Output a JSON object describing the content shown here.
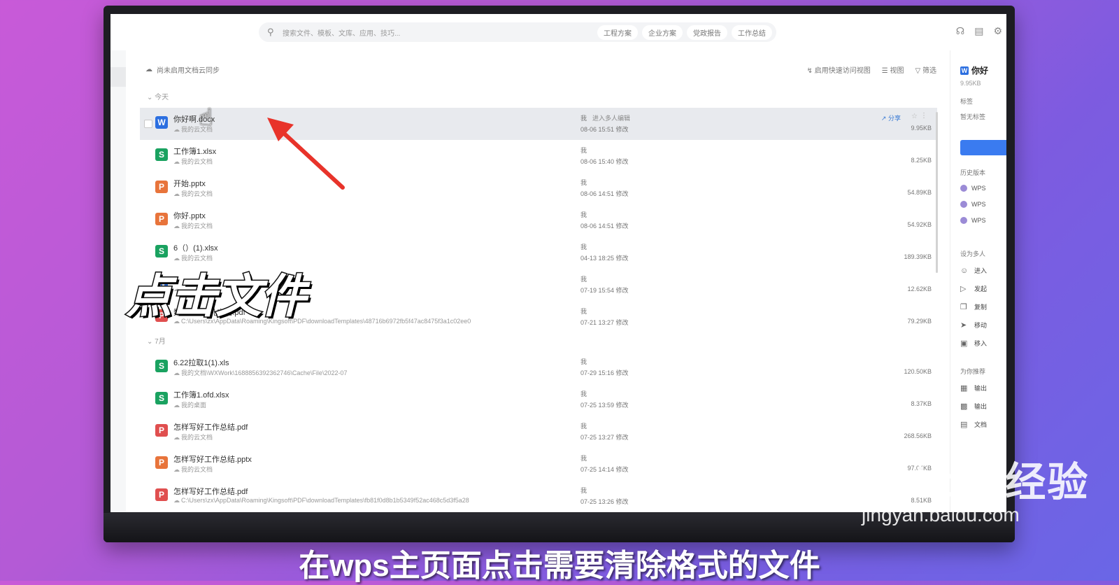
{
  "topbar": {
    "search_placeholder": "搜索文件、模板、文库、应用、技巧...",
    "chips": [
      "工程方案",
      "企业方案",
      "党政报告",
      "工作总结"
    ]
  },
  "toolbar": {
    "sync_text": "尚未启用文档云同步",
    "quick_view": "启用快速访问视图",
    "view": "视图",
    "filter": "筛选"
  },
  "groups": {
    "today": "今天",
    "july": "7月"
  },
  "files_today": [
    {
      "name": "你好啊.docx",
      "location": "我的云文档",
      "owner": "我",
      "collab": "进入多人编辑",
      "modified": "08-06 15:51 修改",
      "size": "9.95KB",
      "type": "W",
      "color": "#2c6fe0"
    },
    {
      "name": "工作簿1.xlsx",
      "location": "我的云文档",
      "owner": "我",
      "modified": "08-06 15:40 修改",
      "size": "8.25KB",
      "type": "S",
      "color": "#1aa260"
    },
    {
      "name": "开始.pptx",
      "location": "我的云文档",
      "owner": "我",
      "modified": "08-06 14:51 修改",
      "size": "54.89KB",
      "type": "P",
      "color": "#e8743b"
    },
    {
      "name": "你好.pptx",
      "location": "我的云文档",
      "owner": "我",
      "modified": "08-06 14:51 修改",
      "size": "54.92KB",
      "type": "P",
      "color": "#e8743b"
    },
    {
      "name": "6（）(1).xlsx",
      "location": "我的云文档",
      "owner": "我",
      "modified": "04-13 18:25 修改",
      "size": "189.39KB",
      "type": "S",
      "color": "#1aa260"
    },
    {
      "name": "",
      "location": "",
      "owner": "我",
      "modified": "07-19 15:54 修改",
      "size": "12.62KB",
      "type": "W",
      "color": "#2c6fe0"
    },
    {
      "name": "数据入门--孔言信.pdf",
      "location": "C:\\Users\\zx\\AppData\\Roaming\\Kingsoft\\PDF\\downloadTemplates\\48716b6972fb5f47ac8475f3a1c02ee0",
      "owner": "我",
      "modified": "07-21 13:27 修改",
      "size": "79.29KB",
      "type": "P",
      "color": "#e04f4f"
    }
  ],
  "files_july": [
    {
      "name": "6.22拉取1(1).xls",
      "location": "我的文档\\WXWork\\1688856392362746\\Cache\\File\\2022-07",
      "owner": "我",
      "modified": "07-29 15:16 修改",
      "size": "120.50KB",
      "type": "S",
      "color": "#1aa260"
    },
    {
      "name": "工作簿1.ofd.xlsx",
      "location": "我的桌面",
      "owner": "我",
      "modified": "07-25 13:59 修改",
      "size": "8.37KB",
      "type": "S",
      "color": "#1aa260"
    },
    {
      "name": "怎样写好工作总结.pdf",
      "location": "我的云文档",
      "owner": "我",
      "modified": "07-25 13:27 修改",
      "size": "268.56KB",
      "type": "P",
      "color": "#e04f4f"
    },
    {
      "name": "怎样写好工作总结.pptx",
      "location": "我的云文档",
      "owner": "我",
      "modified": "07-25 14:14 修改",
      "size": "97.04KB",
      "type": "P",
      "color": "#e8743b"
    },
    {
      "name": "怎样写好工作总结.pdf",
      "location": "C:\\Users\\zx\\AppData\\Roaming\\Kingsoft\\PDF\\downloadTemplates\\fb81f0d8b1b5349f52ac468c5d3f5a28",
      "owner": "我",
      "modified": "07-25 13:26 修改",
      "size": "8.51KB",
      "type": "P",
      "color": "#e04f4f"
    }
  ],
  "row_actions": {
    "share": "分享"
  },
  "panel": {
    "title": "你好",
    "size": "9.95KB",
    "tags_label": "标签",
    "no_tags": "暂无标签",
    "history_label": "历史版本",
    "history": [
      "WPS",
      "WPS",
      "WPS"
    ],
    "multi_label": "设为多人",
    "actions": [
      "进入",
      "发起",
      "复制",
      "移动",
      "移入"
    ],
    "recommend_label": "为你推荐",
    "recommend": [
      "输出",
      "输出",
      "文档"
    ]
  },
  "overlay": {
    "title": "点击文件",
    "caption": "在wps主页面点击需要清除格式的文件",
    "watermark": "Bai du 经验",
    "watermark_url": "jingyan.baidu.com"
  }
}
